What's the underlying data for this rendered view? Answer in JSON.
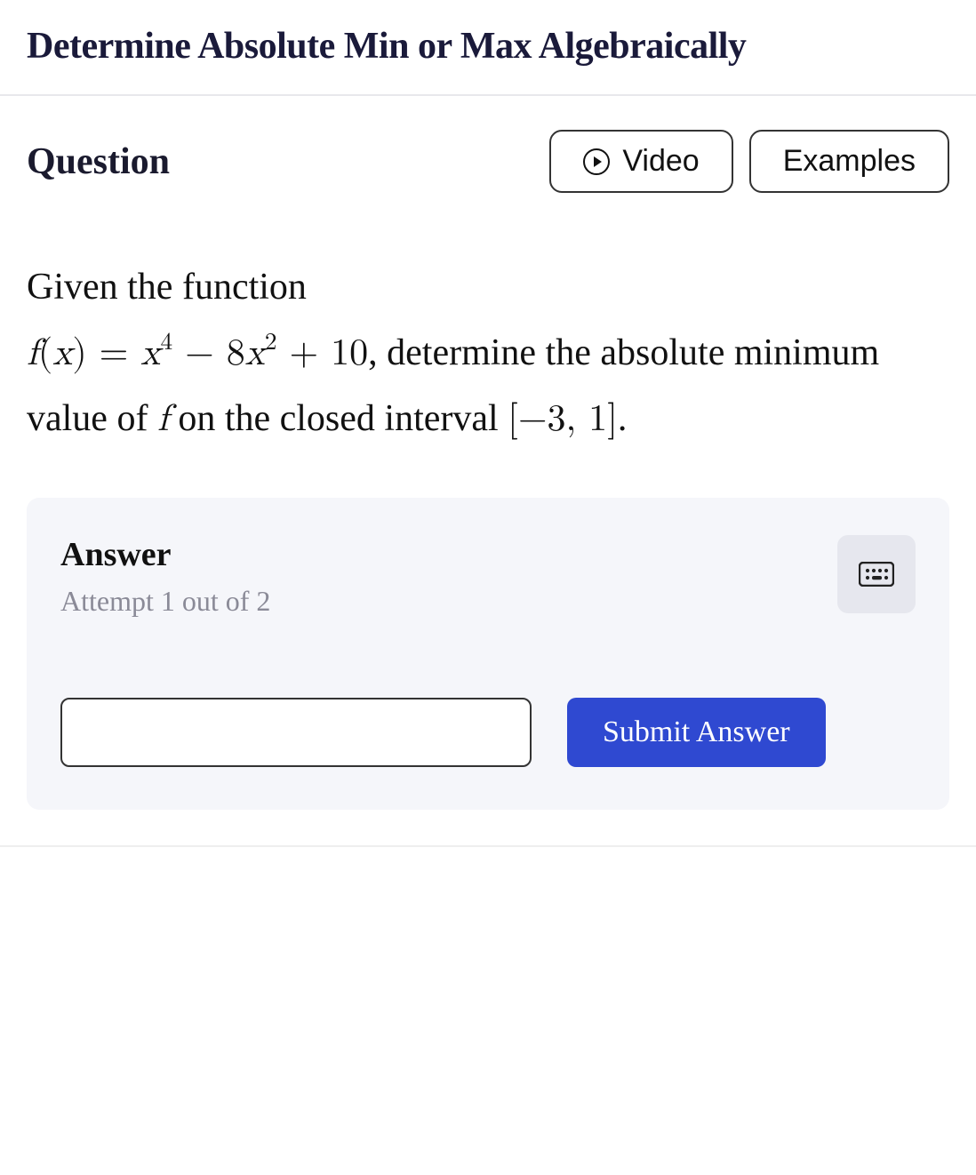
{
  "header": {
    "title": "Determine Absolute Min or Max Algebraically"
  },
  "question": {
    "label": "Question",
    "buttons": {
      "video_label": "Video",
      "examples_label": "Examples"
    },
    "prompt": {
      "pre": "Given the function",
      "func_lhs": "f(x) = ",
      "func_rhs_text": "x^4 − 8x^2 + 10",
      "mid": ", determine the absolute minimum value of ",
      "f_sym": "f",
      "post1": " on the closed interval ",
      "interval": "[−3, 1]",
      "post2": "."
    }
  },
  "answer": {
    "label": "Answer",
    "attempt_text": "Attempt 1 out of 2",
    "input_value": "",
    "submit_label": "Submit Answer"
  },
  "icons": {
    "play": "play-circle-icon",
    "keyboard": "keyboard-icon"
  }
}
